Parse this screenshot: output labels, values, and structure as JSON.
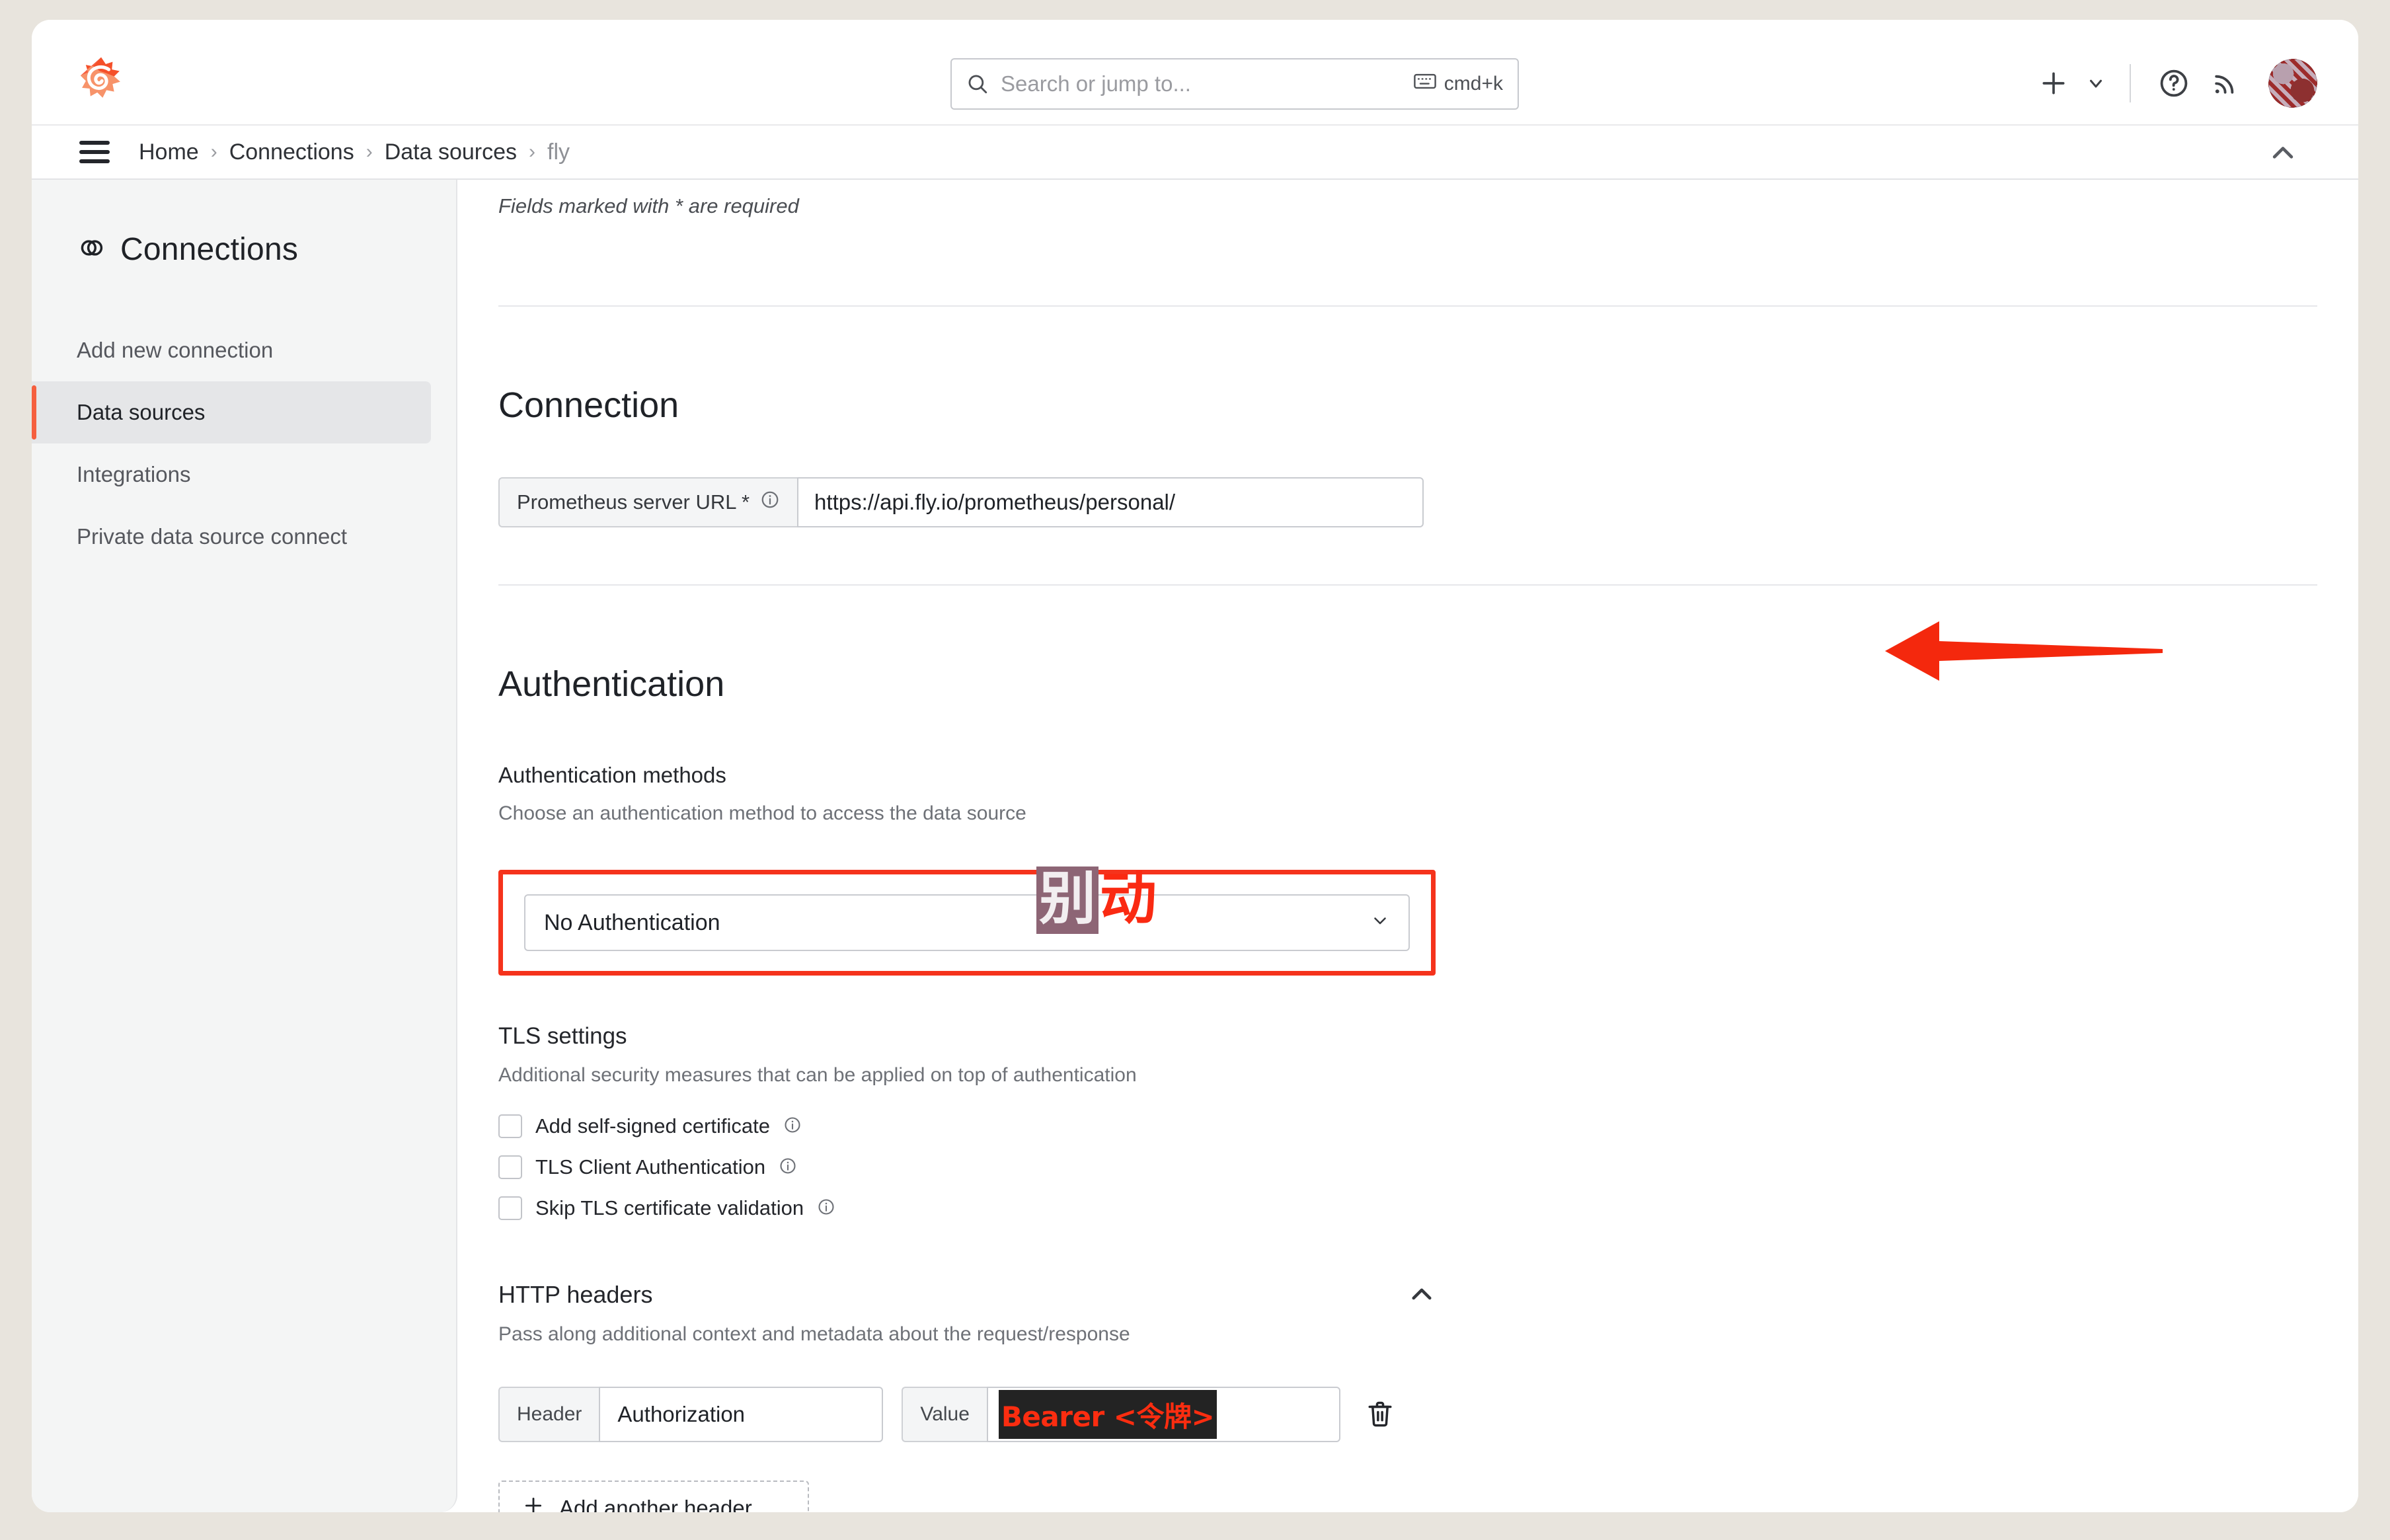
{
  "topbar": {
    "logo_icon": "grafana-logo-icon",
    "search": {
      "placeholder": "Search or jump to...",
      "icon": "search-icon",
      "kbd_icon": "keyboard-icon",
      "kbd_shortcut": "cmd+k"
    },
    "add_icon": "plus-icon",
    "add_chevron_icon": "chevron-down-icon",
    "help_icon": "help-circle-icon",
    "news_icon": "rss-icon",
    "avatar_icon": "user-avatar"
  },
  "breadcrumb": {
    "menu_icon": "hamburger-menu-icon",
    "items": [
      "Home",
      "Connections",
      "Data sources",
      "fly"
    ],
    "separator": "›",
    "collapse_icon": "chevron-up-icon"
  },
  "sidebar": {
    "title": "Connections",
    "title_icon": "connections-rings-icon",
    "items": [
      {
        "label": "Add new connection",
        "active": false
      },
      {
        "label": "Data sources",
        "active": true
      },
      {
        "label": "Integrations",
        "active": false
      },
      {
        "label": "Private data source connect",
        "active": false
      }
    ],
    "active_accent_color": "#f55f3e"
  },
  "main": {
    "required_note": "Fields marked with * are required",
    "connection": {
      "title": "Connection",
      "url_label": "Prometheus server URL *",
      "url_info_icon": "info-circle-icon",
      "url_value": "https://api.fly.io/prometheus/personal/"
    },
    "authentication": {
      "title": "Authentication",
      "methods_label": "Authentication methods",
      "methods_desc": "Choose an authentication method to access the data source",
      "selected_method": "No Authentication",
      "select_chevron_icon": "chevron-down-icon",
      "highlight_color": "#f5331c"
    },
    "tls": {
      "title": "TLS settings",
      "desc": "Additional security measures that can be applied on top of authentication",
      "checkboxes": [
        {
          "label": "Add self-signed certificate",
          "checked": false,
          "info_icon": "info-circle-icon"
        },
        {
          "label": "TLS Client Authentication",
          "checked": false,
          "info_icon": "info-circle-icon"
        },
        {
          "label": "Skip TLS certificate validation",
          "checked": false,
          "info_icon": "info-circle-icon"
        }
      ]
    },
    "http_headers": {
      "title": "HTTP headers",
      "collapse_icon": "chevron-up-icon",
      "desc": "Pass along additional context and metadata about the request/response",
      "rows": [
        {
          "header_prefix": "Header",
          "header_value": "Authorization",
          "value_prefix": "Value",
          "value_redacted_text": "Bearer <令牌>",
          "delete_icon": "trash-icon"
        }
      ],
      "add_button_label": "Add another header",
      "add_button_icon": "plus-icon"
    }
  },
  "annotations": {
    "url_arrow": {
      "icon": "red-arrow-left",
      "color": "#f4280d"
    },
    "note_text_char1": "别",
    "note_text_char2": "动",
    "note_char1_bg": "#8d6575",
    "note_char2_color": "#fa2a12"
  }
}
